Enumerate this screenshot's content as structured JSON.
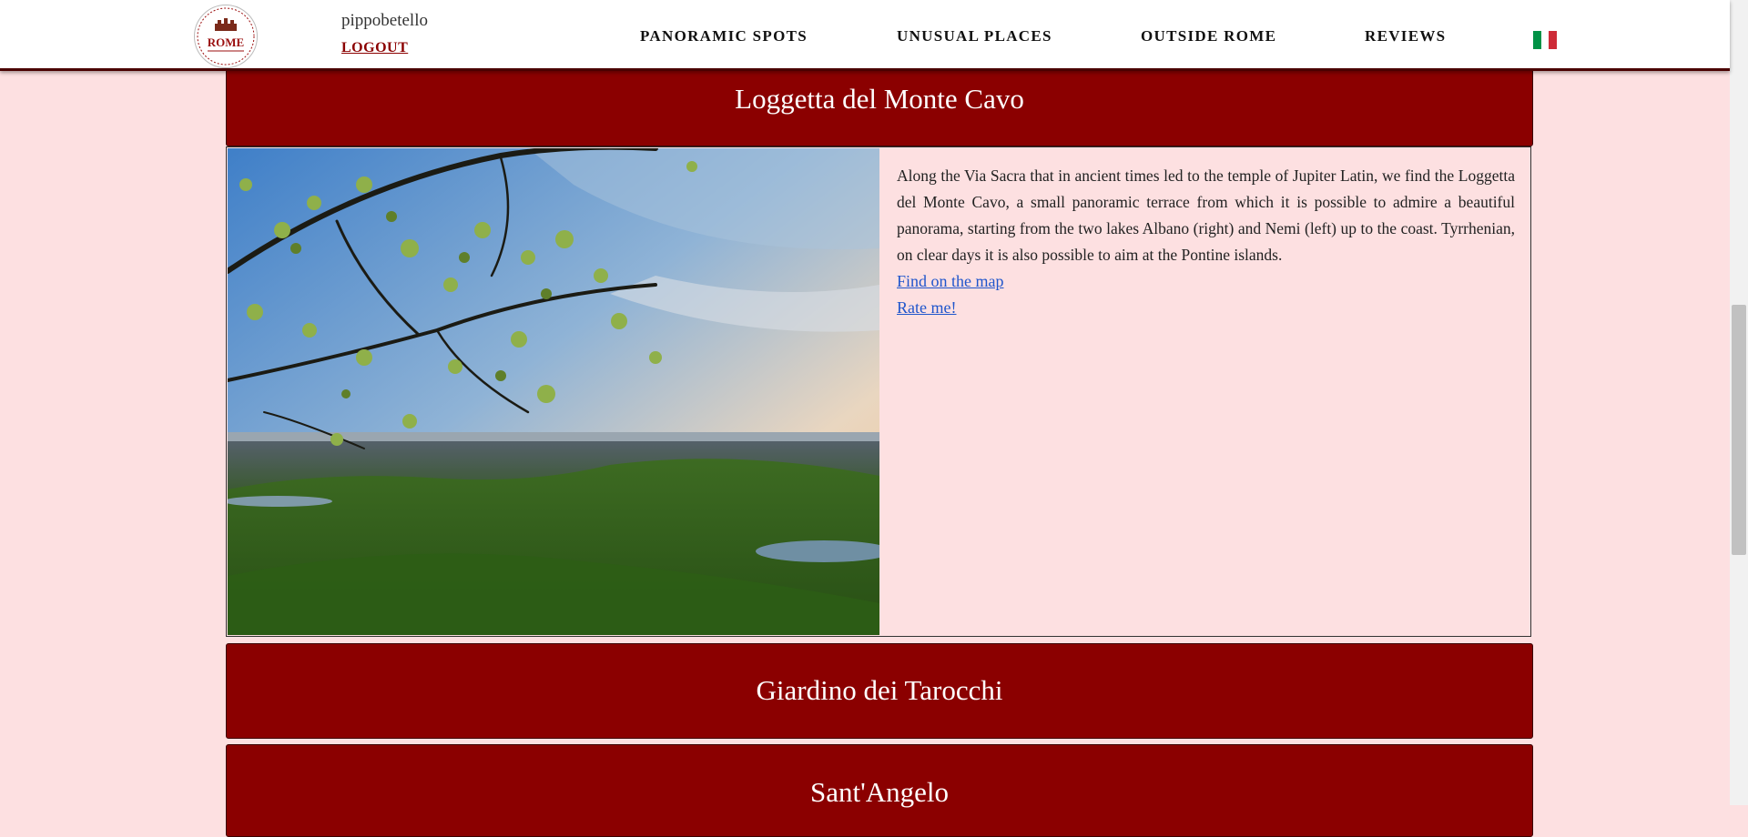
{
  "header": {
    "logo_text": "ROME",
    "username": "pippobetello",
    "logout_label": "LOGOUT",
    "nav": [
      {
        "label": "PANORAMIC SPOTS"
      },
      {
        "label": "UNUSUAL PLACES"
      },
      {
        "label": "OUTSIDE ROME"
      },
      {
        "label": "REVIEWS"
      }
    ],
    "language_icon": "italy-flag-icon"
  },
  "places": [
    {
      "title": "Loggetta del Monte Cavo",
      "description": "Along the Via Sacra that in ancient times led to the temple of Jupiter Latin, we find the Loggetta del Monte Cavo, a small panoramic terrace from which it is possible to admire a beautiful panorama, starting from the two lakes Albano (right) and Nemi (left) up to the coast. Tyrrhenian, on clear days it is also possible to aim at the Pontine islands.",
      "map_link": "Find on the map",
      "rate_link": "Rate me!"
    },
    {
      "title": "Giardino dei Tarocchi"
    },
    {
      "title": "Sant'Angelo"
    }
  ],
  "colors": {
    "page_bg": "#fde0e1",
    "header_bar": "#8b0000",
    "link": "#1f55cc",
    "logout": "#8b0000"
  }
}
